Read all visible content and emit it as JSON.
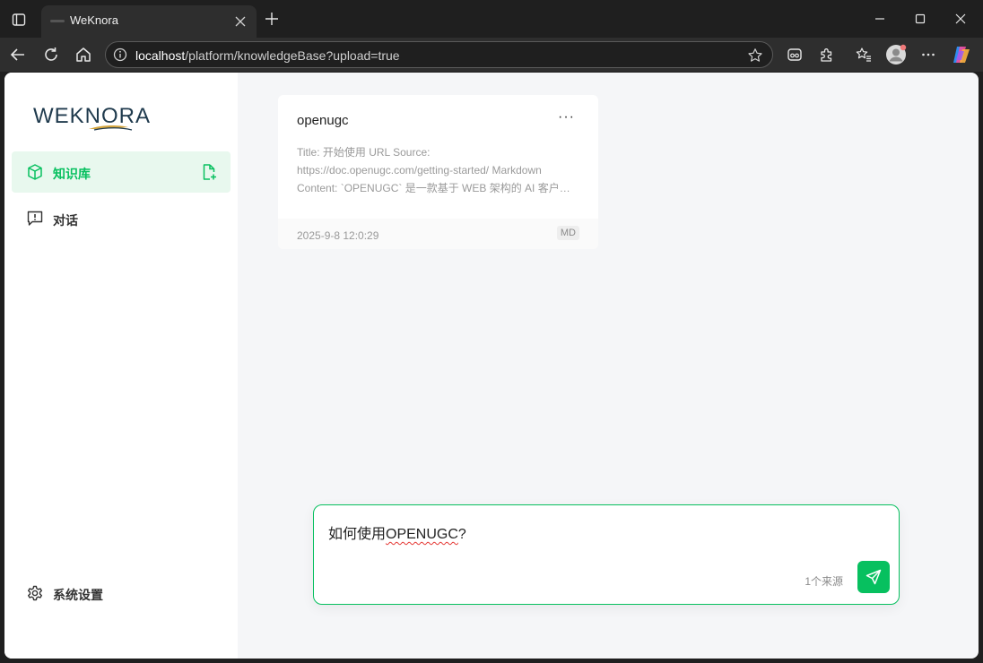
{
  "browser": {
    "tab_title": "WeKnora",
    "url_host": "localhost",
    "url_path": "/platform/knowledgeBase?upload=true"
  },
  "sidebar": {
    "logo_text": "WEKNORA",
    "items": [
      {
        "label": "知识库",
        "icon": "knowledge-base-icon",
        "active": true
      },
      {
        "label": "对话",
        "icon": "chat-icon",
        "active": false
      }
    ],
    "settings_label": "系统设置"
  },
  "knowledge_card": {
    "title": "openugc",
    "description_lines": [
      "Title: 开始使用 URL Source:",
      "https://doc.openugc.com/getting-started/ Markdown",
      "Content: `OPENUGC` 是一款基于 WEB 架构的 AI 客户…"
    ],
    "timestamp": "2025-9-8 12:0:29",
    "file_type": "MD"
  },
  "chat": {
    "input_prefix": "如何使用",
    "input_flagged": "OPENUGC",
    "input_suffix": "?",
    "source_count": "1个来源"
  },
  "colors": {
    "accent": "#07c05f",
    "active_bg": "#e8f8ee",
    "page_bg": "#f5f6f8"
  }
}
